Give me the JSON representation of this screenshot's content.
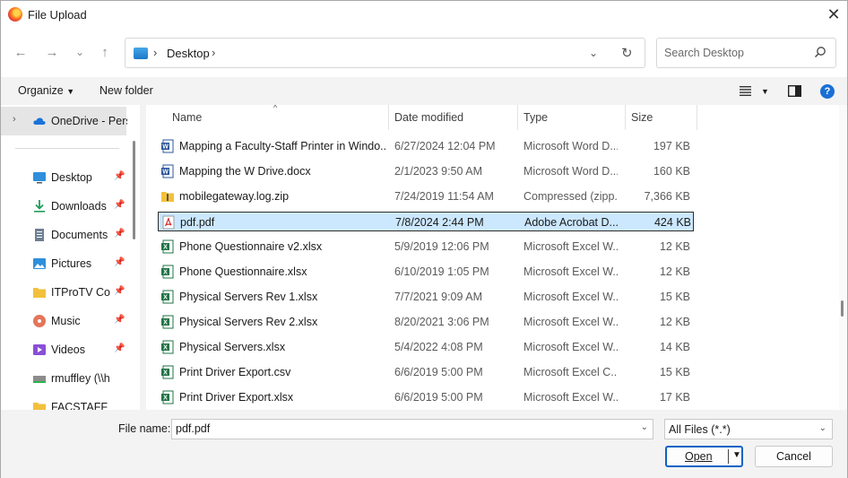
{
  "window": {
    "title": "File Upload",
    "close_glyph": "✕"
  },
  "nav": {
    "back_glyph": "←",
    "forward_glyph": "→",
    "recent_glyph": "⌄",
    "up_glyph": "↑",
    "address": {
      "location": "Desktop",
      "sep": "›"
    },
    "search": {
      "placeholder": "Search Desktop"
    }
  },
  "toolbar": {
    "organize_label": "Organize",
    "new_folder_label": "New folder"
  },
  "sidebar": {
    "onedrive": {
      "label": "OneDrive - Perso",
      "icon": "cloud-icon"
    },
    "items": [
      {
        "label": "Desktop",
        "icon": "desktop-icon",
        "pinned": true
      },
      {
        "label": "Downloads",
        "icon": "download-icon",
        "pinned": true
      },
      {
        "label": "Documents",
        "icon": "documents-icon",
        "pinned": true
      },
      {
        "label": "Pictures",
        "icon": "pictures-icon",
        "pinned": true
      },
      {
        "label": "ITProTV Cou",
        "icon": "folder-icon",
        "pinned": true
      },
      {
        "label": "Music",
        "icon": "music-icon",
        "pinned": true
      },
      {
        "label": "Videos",
        "icon": "videos-icon",
        "pinned": true
      },
      {
        "label": "rmuffley (\\\\hydr",
        "icon": "network-drive-icon",
        "pinned": false
      },
      {
        "label": "FACSTAFF",
        "icon": "folder-icon",
        "pinned": false
      }
    ]
  },
  "columns": {
    "name": "Name",
    "date": "Date modified",
    "type": "Type",
    "size": "Size"
  },
  "files": [
    {
      "name": "Mapping a Faculty-Staff Printer in Windo...",
      "date": "6/27/2024 12:04 PM",
      "type": "Microsoft Word D...",
      "size": "197 KB",
      "icon": "word-icon"
    },
    {
      "name": "Mapping the W Drive.docx",
      "date": "2/1/2023 9:50 AM",
      "type": "Microsoft Word D...",
      "size": "160 KB",
      "icon": "word-icon"
    },
    {
      "name": "mobilegateway.log.zip",
      "date": "7/24/2019 11:54 AM",
      "type": "Compressed (zipp...",
      "size": "7,366 KB",
      "icon": "zip-icon"
    },
    {
      "name": "pdf.pdf",
      "date": "7/8/2024 2:44 PM",
      "type": "Adobe Acrobat D...",
      "size": "424 KB",
      "icon": "pdf-icon",
      "selected": true
    },
    {
      "name": "Phone Questionnaire v2.xlsx",
      "date": "5/9/2019 12:06 PM",
      "type": "Microsoft Excel W...",
      "size": "12 KB",
      "icon": "excel-icon"
    },
    {
      "name": "Phone Questionnaire.xlsx",
      "date": "6/10/2019 1:05 PM",
      "type": "Microsoft Excel W...",
      "size": "12 KB",
      "icon": "excel-icon"
    },
    {
      "name": "Physical Servers Rev 1.xlsx",
      "date": "7/7/2021 9:09 AM",
      "type": "Microsoft Excel W...",
      "size": "15 KB",
      "icon": "excel-icon"
    },
    {
      "name": "Physical Servers Rev 2.xlsx",
      "date": "8/20/2021 3:06 PM",
      "type": "Microsoft Excel W...",
      "size": "12 KB",
      "icon": "excel-icon"
    },
    {
      "name": "Physical Servers.xlsx",
      "date": "5/4/2022 4:08 PM",
      "type": "Microsoft Excel W...",
      "size": "14 KB",
      "icon": "excel-icon"
    },
    {
      "name": "Print Driver Export.csv",
      "date": "6/6/2019 5:00 PM",
      "type": "Microsoft Excel C...",
      "size": "15 KB",
      "icon": "excel-icon"
    },
    {
      "name": "Print Driver Export.xlsx",
      "date": "6/6/2019 5:00 PM",
      "type": "Microsoft Excel W...",
      "size": "17 KB",
      "icon": "excel-icon"
    }
  ],
  "bottom": {
    "file_name_label": "File name:",
    "file_name_value": "pdf.pdf",
    "filter_value": "All Files (*.*)",
    "open_label": "Open",
    "cancel_label": "Cancel"
  },
  "colors": {
    "accent": "#0a64c8",
    "selection": "#cce8ff",
    "word": "#2b579a",
    "excel": "#217346",
    "pdf": "#d32f2f",
    "folder": "#f2c03c"
  }
}
